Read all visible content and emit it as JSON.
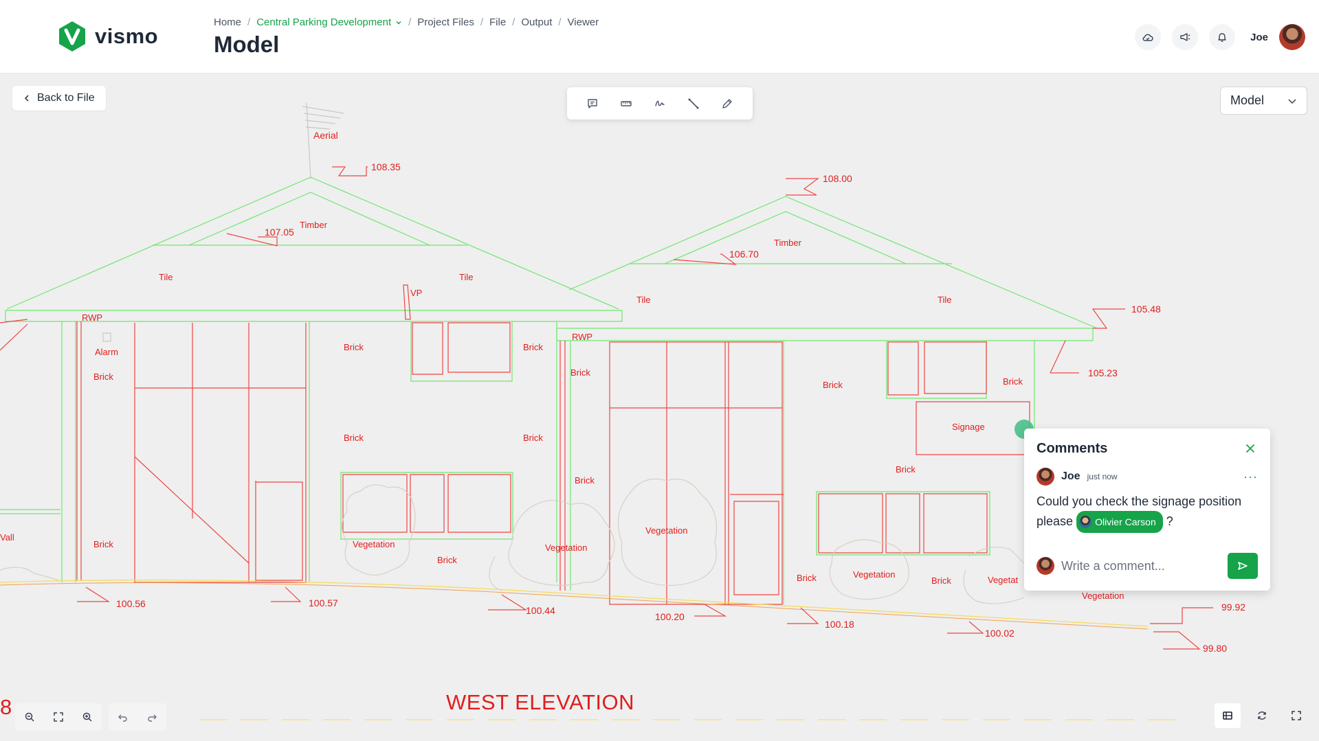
{
  "brand": {
    "name": "vismo",
    "color": "#16a34a"
  },
  "breadcrumb": [
    "Home",
    "Central Parking Development",
    "Project Files",
    "File",
    "Output",
    "Viewer"
  ],
  "page_title": "Model",
  "header": {
    "user_name": "Joe"
  },
  "back_button": "Back to File",
  "model_select": {
    "value": "Model"
  },
  "drawing": {
    "title": "WEST ELEVATION",
    "labels": {
      "aerial": "Aerial",
      "l10835": "108.35",
      "l10800": "108.00",
      "timber1": "Timber",
      "timber2": "Timber",
      "l10705": "107.05",
      "l10670": "106.70",
      "tile1": "Tile",
      "tile2": "Tile",
      "tile3": "Tile",
      "tile4": "Tile",
      "vp": "VP",
      "rwp1": "RWP",
      "rwp2": "RWP",
      "l10548": "105.48",
      "l10523": "105.23",
      "alarm": "Alarm",
      "b1": "Brick",
      "b2": "Brick",
      "b3": "Brick",
      "b4": "Brick",
      "b5": "Brick",
      "b6": "Brick",
      "b7": "Brick",
      "b8": "Brick",
      "b9": "Brick",
      "b10": "Brick",
      "b11": "Brick",
      "b12": "Brick",
      "b13": "Brick",
      "b14": "Brick",
      "b15": "Brick",
      "b16": "Brick",
      "signage": "Signage",
      "wall": "Vall",
      "v1": "Vegetation",
      "v2": "Vegetation",
      "v3": "Vegetation",
      "v4": "Vegetation",
      "v5": "Vegetat",
      "v6": "Vegetation",
      "l10056": "100.56",
      "l10057": "100.57",
      "l10044": "100.44",
      "l10020": "100.20",
      "l10018": "100.18",
      "l10002": "100.02",
      "l9992": "99.92",
      "l9980": "99.80",
      "edge": "8"
    }
  },
  "comments": {
    "title": "Comments",
    "author": "Joe",
    "time": "just now",
    "more": "···",
    "text_before": "Could you check the signage position please",
    "mention": "Olivier Carson",
    "text_after": "?",
    "input_placeholder": "Write a comment..."
  },
  "icons": {
    "toolbar": [
      "comment-icon",
      "ruler-icon",
      "signature-icon",
      "line-measure-icon",
      "pencil-icon"
    ],
    "header": [
      "cloud-icon",
      "megaphone-icon",
      "bell-icon"
    ]
  }
}
